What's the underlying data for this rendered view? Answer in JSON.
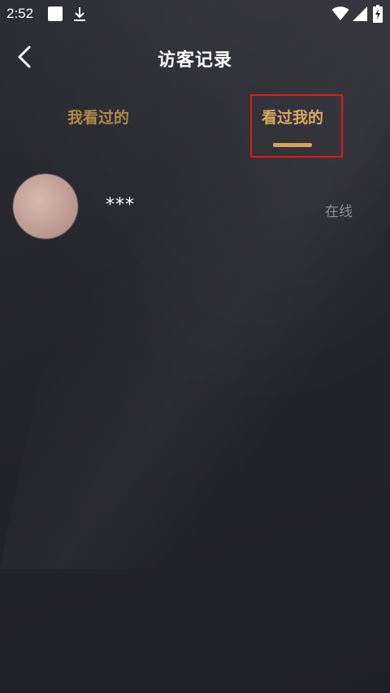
{
  "status_bar": {
    "time": "2:52",
    "icons": [
      "notification-square-icon",
      "download-icon",
      "wifi-icon",
      "cell-signal-icon",
      "battery-charging-icon"
    ]
  },
  "header": {
    "title": "访客记录",
    "back_icon": "chevron-left-icon"
  },
  "tabs": [
    {
      "label": "我看过的",
      "selected": false
    },
    {
      "label": "看过我的",
      "selected": true
    }
  ],
  "colors": {
    "accent": "#d6a25c",
    "tab_inactive": "#b08a4a",
    "highlight_box": "#e01b1b",
    "background": "#24242b",
    "muted_text": "#8f8f95"
  },
  "visitors": [
    {
      "name": "***",
      "status": "在线"
    }
  ]
}
